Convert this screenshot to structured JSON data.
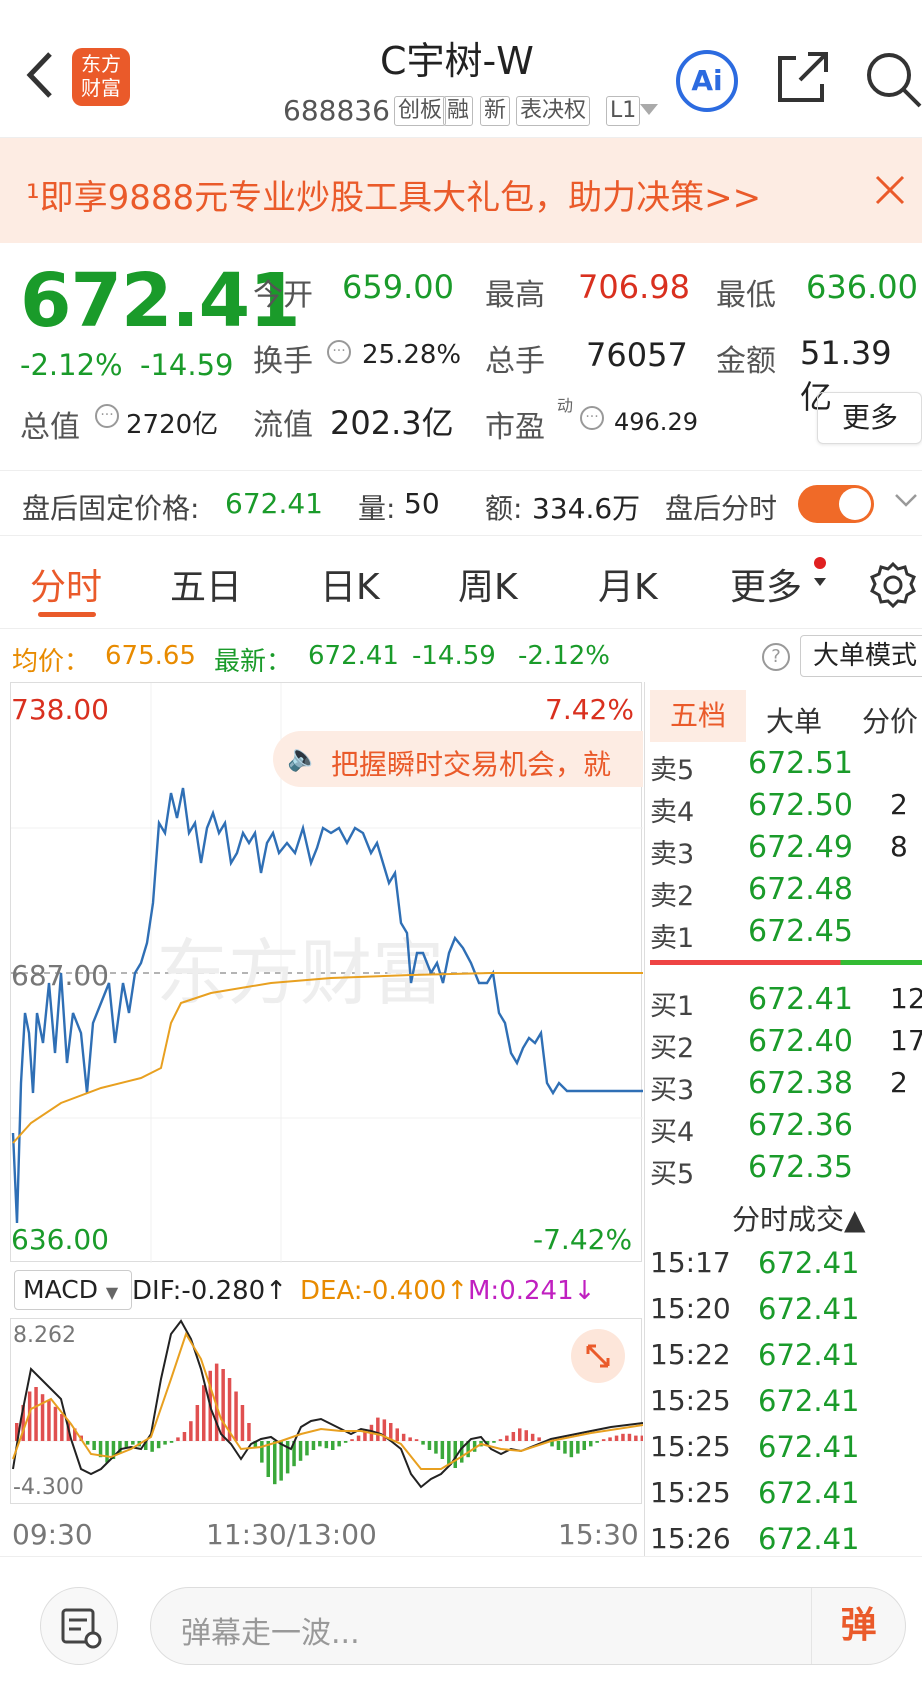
{
  "header": {
    "title": "C宇树-W",
    "code": "688836",
    "tags": [
      "创板",
      "融",
      "新",
      "表决权",
      "L1"
    ],
    "logo_text": "东方\n财富",
    "ai_label": "Ai"
  },
  "banner": {
    "text": "¹即享9888元专业炒股工具大礼包，助力决策>>"
  },
  "quote": {
    "price": "672.41",
    "pct": "-2.12%",
    "chg": "-14.59",
    "open_label": "今开",
    "open": "659.00",
    "high_label": "最高",
    "high": "706.98",
    "low_label": "最低",
    "low": "636.00",
    "turn_label": "换手",
    "turn": "25.28%",
    "vol_label": "总手",
    "vol": "76057",
    "amt_label": "金额",
    "amt": "51.39亿",
    "mcap_label": "总值",
    "mcap": "2720亿",
    "float_label": "流值",
    "float": "202.3亿",
    "pe_label": "市盈",
    "pe_sup": "动",
    "pe": "496.29",
    "more": "更多"
  },
  "after": {
    "fixed_label": "盘后固定价格:",
    "fixed": "672.41",
    "vol_label": "量:",
    "vol": "50",
    "amt_label": "额:",
    "amt": "334.6万",
    "toggle_label": "盘后分时"
  },
  "tabs": [
    "分时",
    "五日",
    "日K",
    "周K",
    "月K",
    "更多"
  ],
  "infobar": {
    "avg_label": "均价：",
    "avg": "675.65",
    "latest_label": "最新：",
    "latest": "672.41",
    "chg": "-14.59",
    "pct": "-2.12%",
    "mode": "大单模式"
  },
  "chart": {
    "top_price": "738.00",
    "top_pct": "7.42%",
    "mid_price": "687.00",
    "bot_price": "636.00",
    "bot_pct": "-7.42%",
    "tip": "把握瞬时交易机会，就",
    "watermark": "东方财富",
    "x_labels": [
      "09:30",
      "11:30/13:00",
      "15:30"
    ]
  },
  "macd": {
    "label": "MACD",
    "dif": "DIF:-0.280↑",
    "dea": "DEA:-0.400↑",
    "m": "M:0.241↓",
    "top": "8.262",
    "bot": "-4.300"
  },
  "orderbook": {
    "tabs": [
      "五档",
      "大单",
      "分价"
    ],
    "sells": [
      {
        "l": "卖5",
        "p": "672.51",
        "v": ""
      },
      {
        "l": "卖4",
        "p": "672.50",
        "v": "2"
      },
      {
        "l": "卖3",
        "p": "672.49",
        "v": "8"
      },
      {
        "l": "卖2",
        "p": "672.48",
        "v": ""
      },
      {
        "l": "卖1",
        "p": "672.45",
        "v": ""
      }
    ],
    "buys": [
      {
        "l": "买1",
        "p": "672.41",
        "v": "12"
      },
      {
        "l": "买2",
        "p": "672.40",
        "v": "17"
      },
      {
        "l": "买3",
        "p": "672.38",
        "v": "2"
      },
      {
        "l": "买4",
        "p": "672.36",
        "v": ""
      },
      {
        "l": "买5",
        "p": "672.35",
        "v": ""
      }
    ]
  },
  "trades": {
    "title": "分时成交▲",
    "rows": [
      {
        "t": "15:17",
        "p": "672.41"
      },
      {
        "t": "15:20",
        "p": "672.41"
      },
      {
        "t": "15:22",
        "p": "672.41"
      },
      {
        "t": "15:25",
        "p": "672.41"
      },
      {
        "t": "15:25",
        "p": "672.41"
      },
      {
        "t": "15:25",
        "p": "672.41"
      },
      {
        "t": "15:26",
        "p": "672.41"
      }
    ]
  },
  "bottom": {
    "placeholder": "弹幕走一波...",
    "danmu": "弹"
  }
}
